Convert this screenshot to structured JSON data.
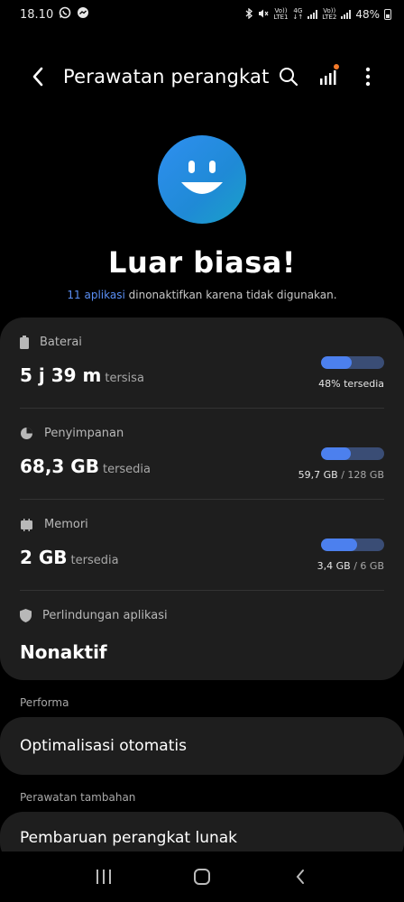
{
  "status_bar": {
    "time": "18.10",
    "carrier1_top": "Vo))",
    "carrier1_bottom": "LTE1",
    "network_top": "4G",
    "network_bottom": "↓↑",
    "carrier2_top": "Vo))",
    "carrier2_bottom": "LTE2",
    "battery_percent": "48%"
  },
  "app_bar": {
    "title": "Perawatan perangkat"
  },
  "hero": {
    "headline": "Luar biasa!",
    "link_text": "11 aplikasi",
    "subtitle": " dinonaktifkan karena tidak digunakan."
  },
  "metrics": {
    "battery": {
      "label": "Baterai",
      "value": "5 j 39 m",
      "unit": "tersisa",
      "fill_fraction": 0.48,
      "detail": "48% tersedia"
    },
    "storage": {
      "label": "Penyimpanan",
      "value": "68,3 GB",
      "unit": "tersedia",
      "fill_fraction": 0.47,
      "detail_used": "59,7 GB",
      "detail_total": " / 128 GB"
    },
    "memory": {
      "label": "Memori",
      "value": "2 GB",
      "unit": "tersedia",
      "fill_fraction": 0.57,
      "detail_used": "3,4 GB",
      "detail_total": " / 6 GB"
    },
    "protection": {
      "label": "Perlindungan aplikasi",
      "value": "Nonaktif"
    }
  },
  "sections": {
    "performance_header": "Performa",
    "auto_optimize": "Optimalisasi otomatis",
    "extra_header": "Perawatan tambahan",
    "software_update": "Pembaruan perangkat lunak"
  },
  "colors": {
    "accent": "#4c80ee",
    "card": "#1e1e1e",
    "notification_dot": "#f47a2a"
  }
}
